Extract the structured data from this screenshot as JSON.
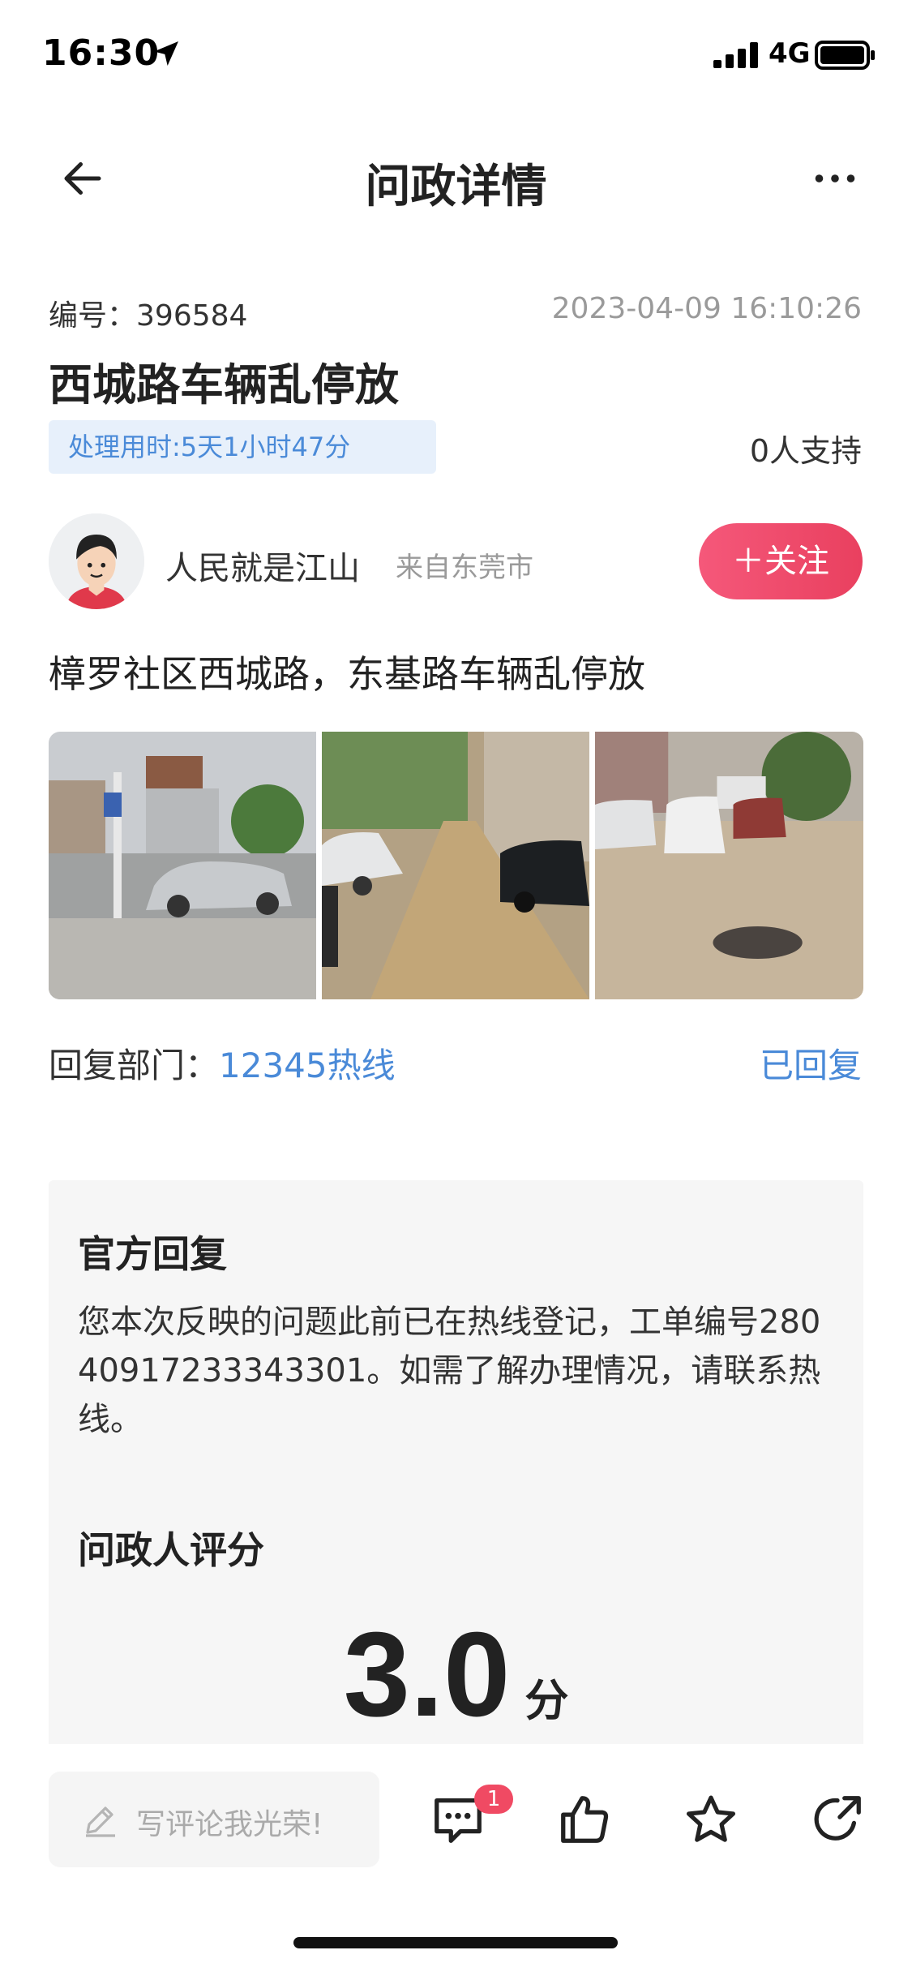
{
  "status_bar": {
    "time": "16:30",
    "network": "4G",
    "icons": [
      "location-arrow-icon",
      "signal-icon",
      "battery-icon"
    ]
  },
  "nav": {
    "title": "问政详情",
    "back_icon": "back-arrow-icon",
    "more_icon": "more-icon"
  },
  "meta": {
    "id_label": "编号：",
    "id_value": "396584",
    "datetime": "2023-04-09 16:10:26",
    "headline": "西城路车辆乱停放",
    "duration": "处理用时:5天1小时47分",
    "support": "0人支持"
  },
  "author": {
    "name": "人民就是江山",
    "from": "来自东莞市",
    "follow_label": "＋关注"
  },
  "content": {
    "text": "樟罗社区西城路，东基路车辆乱停放"
  },
  "reply_dept": {
    "label": "回复部门：",
    "name": "12345热线",
    "status": "已回复"
  },
  "official_reply": {
    "title": "官方回复",
    "body": "您本次反映的问题此前已在热线登记，工单编号28040917233343301。如需了解办理情况，请联系热线。",
    "rating_title": "问政人评分",
    "score": "3.0",
    "score_unit": "分"
  },
  "bottom_bar": {
    "comment_placeholder": "写评论我光荣!",
    "comment_count": "1",
    "icons": [
      "pen-icon",
      "comment-icon",
      "like-icon",
      "star-icon",
      "share-icon"
    ]
  },
  "colors": {
    "accent_blue": "#4a8ad8",
    "follow_pink": "#ee4c6b",
    "badge_red": "#f04a63"
  }
}
